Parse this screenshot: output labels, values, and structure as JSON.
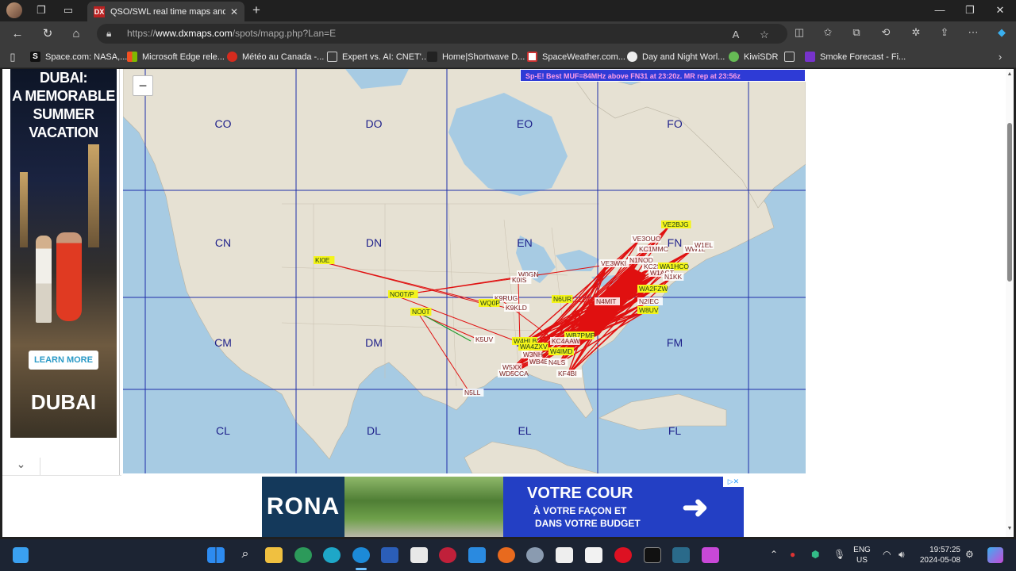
{
  "browser": {
    "tab_title": "QSO/SWL real time maps and lis",
    "url_prefix": "https://",
    "url_host": "www.dxmaps.com",
    "url_path": "/spots/mapg.php?Lan=E"
  },
  "bookmarks": [
    {
      "label": "Space.com: NASA,...",
      "icon": "space-icon",
      "color": "#111"
    },
    {
      "label": "Microsoft Edge rele...",
      "icon": "microsoft-icon",
      "color": "#f25022"
    },
    {
      "label": "Météo au Canada -...",
      "icon": "maple-leaf-icon",
      "color": "#d52b1e"
    },
    {
      "label": "Expert vs. AI: CNET'...",
      "icon": "page-icon",
      "color": "#ddd"
    },
    {
      "label": "Home|Shortwave D...",
      "icon": "antenna-icon",
      "color": "#999"
    },
    {
      "label": "SpaceWeather.com...",
      "icon": "spaceweather-icon",
      "color": "#c33"
    },
    {
      "label": "Day and Night Worl...",
      "icon": "globe-icon",
      "color": "#ddd"
    },
    {
      "label": "KiwiSDR",
      "icon": "kiwi-icon",
      "color": "#6b5"
    },
    {
      "label": "Smoke Forecast - Fi...",
      "icon": "smoke-icon",
      "color": "#73c"
    }
  ],
  "ad_left": {
    "headline_1": "DUBAI:",
    "headline_2": "A MEMORABLE",
    "headline_3": "SUMMER",
    "headline_4": "VACATION",
    "cta": "LEARN MORE",
    "brand": "DUBAI"
  },
  "map": {
    "zoom_out_label": "−",
    "banner": "Sp-E! Best MUF=84MHz above FN31 at 23:20z. MR rep at 23:56z",
    "grid_labels": [
      {
        "text": "CO",
        "col": 0,
        "row": 0
      },
      {
        "text": "DO",
        "col": 1,
        "row": 0
      },
      {
        "text": "EO",
        "col": 2,
        "row": 0
      },
      {
        "text": "FO",
        "col": 3,
        "row": 0
      },
      {
        "text": "CN",
        "col": 0,
        "row": 1
      },
      {
        "text": "DN",
        "col": 1,
        "row": 1
      },
      {
        "text": "EN",
        "col": 2,
        "row": 1
      },
      {
        "text": "FN",
        "col": 3,
        "row": 1
      },
      {
        "text": "CM",
        "col": 0,
        "row": 2
      },
      {
        "text": "DM",
        "col": 1,
        "row": 2
      },
      {
        "text": "EM",
        "col": 2,
        "row": 2
      },
      {
        "text": "FM",
        "col": 3,
        "row": 2
      },
      {
        "text": "CL",
        "col": 0,
        "row": 3
      },
      {
        "text": "DL",
        "col": 1,
        "row": 3
      },
      {
        "text": "EL",
        "col": 2,
        "row": 3
      },
      {
        "text": "FL",
        "col": 3,
        "row": 3
      }
    ],
    "stations": [
      {
        "call": "VE2BJG",
        "style": "yellow"
      },
      {
        "call": "VE3OUO",
        "style": "white"
      },
      {
        "call": "KC1MMC",
        "style": "white"
      },
      {
        "call": "WW1L",
        "style": "white"
      },
      {
        "call": "W1EL",
        "style": "white"
      },
      {
        "call": "VE3WKI",
        "style": "white"
      },
      {
        "call": "N1NQD",
        "style": "white"
      },
      {
        "call": "KC2S",
        "style": "white"
      },
      {
        "call": "WA1HCO",
        "style": "yellow"
      },
      {
        "call": "W1AGT",
        "style": "white"
      },
      {
        "call": "N1KK",
        "style": "white"
      },
      {
        "call": "WA2FZW",
        "style": "yellow"
      },
      {
        "call": "N4MIT",
        "style": "white"
      },
      {
        "call": "N2IEC",
        "style": "white"
      },
      {
        "call": "W8UV",
        "style": "yellow"
      },
      {
        "call": "W0GN",
        "style": "white"
      },
      {
        "call": "K0IS",
        "style": "white"
      },
      {
        "call": "K9RUG",
        "style": "white"
      },
      {
        "call": "N6UR",
        "style": "yellow"
      },
      {
        "call": "WQ0P",
        "style": "yellow"
      },
      {
        "call": "K9KLD",
        "style": "white"
      },
      {
        "call": "KI0E",
        "style": "yellow"
      },
      {
        "call": "NO0T/P",
        "style": "yellow"
      },
      {
        "call": "NO0T",
        "style": "yellow"
      },
      {
        "call": "K5UV",
        "style": "white"
      },
      {
        "call": "WB7PMP",
        "style": "yellow"
      },
      {
        "call": "W4HLB",
        "style": "yellow"
      },
      {
        "call": "KC4AAW",
        "style": "white"
      },
      {
        "call": "WA4ZXV",
        "style": "yellow"
      },
      {
        "call": "W4IMD",
        "style": "yellow"
      },
      {
        "call": "W3NH",
        "style": "white"
      },
      {
        "call": "WB4E",
        "style": "white"
      },
      {
        "call": "N4LS",
        "style": "white"
      },
      {
        "call": "W5XX",
        "style": "white"
      },
      {
        "call": "WD5CCA",
        "style": "white"
      },
      {
        "call": "KF4BI",
        "style": "white"
      },
      {
        "call": "N5LL",
        "style": "white"
      }
    ]
  },
  "ad_bottom": {
    "brand": "RONA",
    "line1": "VOTRE COUR",
    "line2": "À VOTRE FAÇON ET",
    "line3": "DANS VOTRE BUDGET",
    "arrow": "➜"
  },
  "taskbar": {
    "language_1": "ENG",
    "language_2": "US",
    "time": "19:57:25",
    "date": "2024-05-08"
  },
  "colors": {
    "map_water": "#a7cbe3",
    "map_land": "#e6e1d3",
    "grid_line": "#1f2ea8",
    "path_line": "#e01010",
    "banner_bg": "#2e3bd6"
  }
}
